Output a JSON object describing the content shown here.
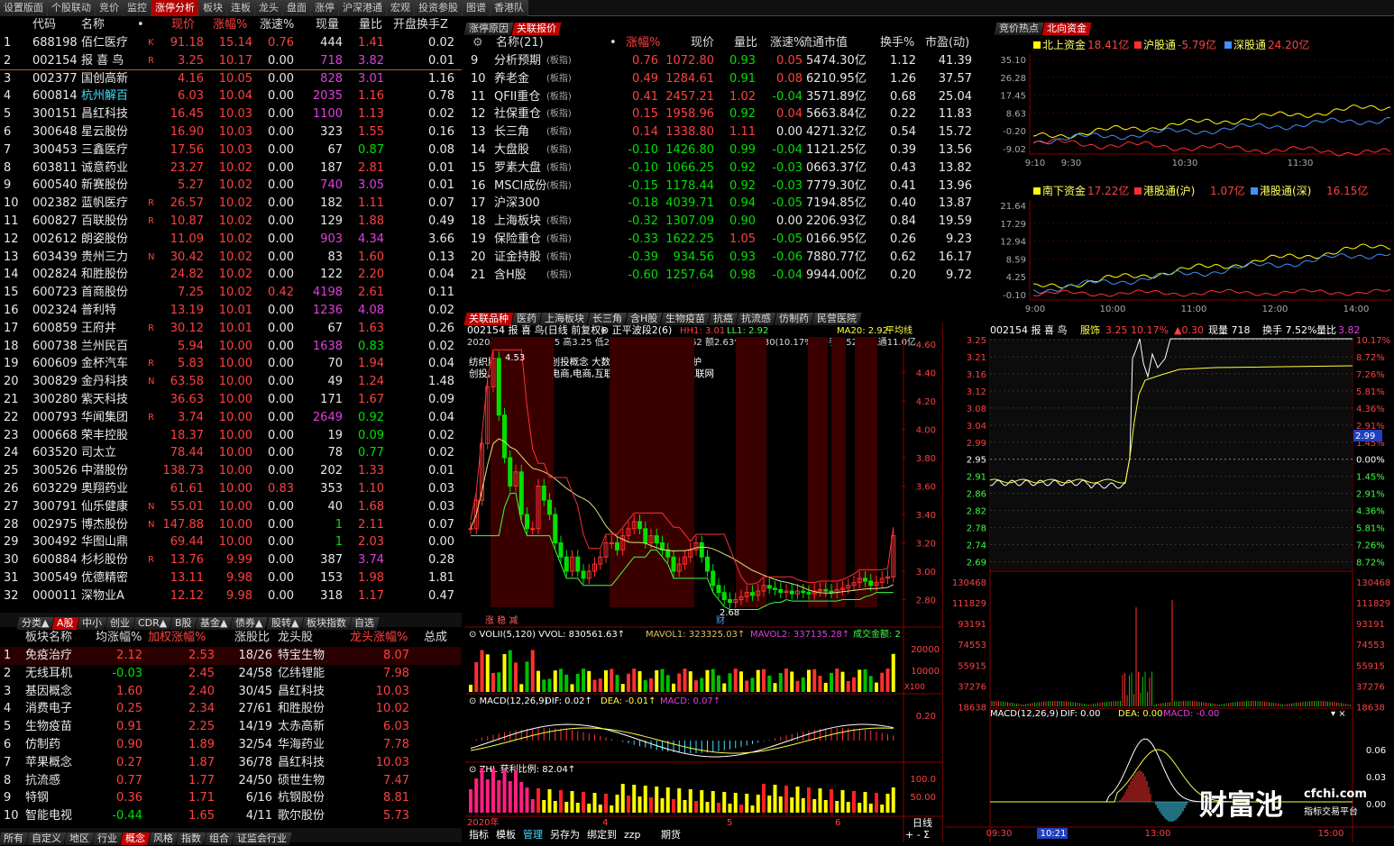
{
  "top_tabs": [
    {
      "label": "设置版面",
      "active": false
    },
    {
      "label": "个股联动",
      "active": false
    },
    {
      "label": "竞价",
      "active": false
    },
    {
      "label": "监控",
      "active": false
    },
    {
      "label": "涨停分析",
      "active": true
    },
    {
      "label": "板块",
      "active": false
    },
    {
      "label": "连板",
      "active": false
    },
    {
      "label": "龙头",
      "active": false
    },
    {
      "label": "盘面",
      "active": false
    },
    {
      "label": "涨停",
      "active": false
    },
    {
      "label": "沪深港通",
      "active": false
    },
    {
      "label": "宏观",
      "active": false
    },
    {
      "label": "投资参股",
      "active": false
    },
    {
      "label": "图谱",
      "active": false
    },
    {
      "label": "香港队",
      "active": false
    }
  ],
  "stock_list": {
    "headers": [
      "代码",
      "名称",
      "•",
      "现价",
      "涨幅%",
      "涨速%",
      "现量",
      "量比",
      "开盘换手Z"
    ],
    "rows": [
      [
        "1",
        "688198",
        "佰仁医疗",
        "K",
        "91.18",
        "15.14",
        "0.76",
        "444",
        "1.41",
        "0.02"
      ],
      [
        "2",
        "002154",
        "报 喜 鸟",
        "R",
        "3.25",
        "10.17",
        "0.00",
        "718",
        "3.82",
        "0.01"
      ],
      [
        "3",
        "002377",
        "国创高新",
        "",
        "4.16",
        "10.05",
        "0.00",
        "828",
        "3.01",
        "1.16"
      ],
      [
        "4",
        "600814",
        "杭州解百",
        "",
        "6.03",
        "10.04",
        "0.00",
        "2035",
        "1.16",
        "0.78"
      ],
      [
        "5",
        "300151",
        "昌红科技",
        "",
        "16.45",
        "10.03",
        "0.00",
        "1100",
        "1.13",
        "0.02"
      ],
      [
        "6",
        "300648",
        "星云股份",
        "",
        "16.90",
        "10.03",
        "0.00",
        "323",
        "1.55",
        "0.16"
      ],
      [
        "7",
        "300453",
        "三鑫医疗",
        "",
        "17.56",
        "10.03",
        "0.00",
        "67",
        "0.87",
        "0.08"
      ],
      [
        "8",
        "603811",
        "诚意药业",
        "",
        "23.27",
        "10.02",
        "0.00",
        "187",
        "2.81",
        "0.01"
      ],
      [
        "9",
        "600540",
        "新赛股份",
        "",
        "5.27",
        "10.02",
        "0.00",
        "740",
        "3.05",
        "0.01"
      ],
      [
        "10",
        "002382",
        "蓝帆医疗",
        "R",
        "26.57",
        "10.02",
        "0.00",
        "182",
        "1.11",
        "0.07"
      ],
      [
        "11",
        "600827",
        "百联股份",
        "R",
        "10.87",
        "10.02",
        "0.00",
        "129",
        "1.88",
        "0.49"
      ],
      [
        "12",
        "002612",
        "朗姿股份",
        "",
        "11.09",
        "10.02",
        "0.00",
        "903",
        "4.34",
        "3.66"
      ],
      [
        "13",
        "603439",
        "贵州三力",
        "N",
        "30.42",
        "10.02",
        "0.00",
        "83",
        "1.60",
        "0.13"
      ],
      [
        "14",
        "002824",
        "和胜股份",
        "",
        "24.82",
        "10.02",
        "0.00",
        "122",
        "2.20",
        "0.04"
      ],
      [
        "15",
        "600723",
        "首商股份",
        "",
        "7.25",
        "10.02",
        "0.42",
        "4198",
        "2.61",
        "0.11"
      ],
      [
        "16",
        "002324",
        "普利特",
        "",
        "13.19",
        "10.01",
        "0.00",
        "1236",
        "4.08",
        "0.02"
      ],
      [
        "17",
        "600859",
        "王府井",
        "R",
        "30.12",
        "10.01",
        "0.00",
        "67",
        "1.63",
        "0.26"
      ],
      [
        "18",
        "600738",
        "兰州民百",
        "",
        "5.94",
        "10.00",
        "0.00",
        "1638",
        "0.83",
        "0.02"
      ],
      [
        "19",
        "600609",
        "金杯汽车",
        "R",
        "5.83",
        "10.00",
        "0.00",
        "70",
        "1.94",
        "0.04"
      ],
      [
        "20",
        "300829",
        "金丹科技",
        "N",
        "63.58",
        "10.00",
        "0.00",
        "49",
        "1.24",
        "1.48"
      ],
      [
        "21",
        "300280",
        "紫天科技",
        "",
        "36.63",
        "10.00",
        "0.00",
        "171",
        "1.67",
        "0.09"
      ],
      [
        "22",
        "000793",
        "华闻集团",
        "R",
        "3.74",
        "10.00",
        "0.00",
        "2649",
        "0.92",
        "0.04"
      ],
      [
        "23",
        "000668",
        "荣丰控股",
        "",
        "18.37",
        "10.00",
        "0.00",
        "19",
        "0.09",
        "0.02"
      ],
      [
        "24",
        "603520",
        "司太立",
        "",
        "78.44",
        "10.00",
        "0.00",
        "78",
        "0.77",
        "0.02"
      ],
      [
        "25",
        "300526",
        "中潜股份",
        "",
        "138.73",
        "10.00",
        "0.00",
        "202",
        "1.33",
        "0.01"
      ],
      [
        "26",
        "603229",
        "奥翔药业",
        "",
        "61.61",
        "10.00",
        "0.83",
        "353",
        "1.10",
        "0.03"
      ],
      [
        "27",
        "300791",
        "仙乐健康",
        "N",
        "55.01",
        "10.00",
        "0.00",
        "40",
        "1.68",
        "0.03"
      ],
      [
        "28",
        "002975",
        "博杰股份",
        "N",
        "147.88",
        "10.00",
        "0.00",
        "1",
        "2.11",
        "0.07"
      ],
      [
        "29",
        "300492",
        "华图山鼎",
        "",
        "69.44",
        "10.00",
        "0.00",
        "1",
        "2.03",
        "0.00"
      ],
      [
        "30",
        "600884",
        "杉杉股份",
        "R",
        "13.76",
        "9.99",
        "0.00",
        "387",
        "3.74",
        "0.28"
      ],
      [
        "31",
        "300549",
        "优德精密",
        "",
        "13.11",
        "9.98",
        "0.00",
        "153",
        "1.98",
        "1.81"
      ],
      [
        "32",
        "000011",
        "深物业A",
        "",
        "12.12",
        "9.98",
        "0.00",
        "318",
        "1.17",
        "0.47"
      ]
    ]
  },
  "left_mid_tabs": [
    "分类▲",
    "A股",
    "中小",
    "创业",
    "CDR▲",
    "B股",
    "基金▲",
    "债券▲",
    "股转▲",
    "板块指数",
    "自选"
  ],
  "sector_list": {
    "headers": [
      "板块名称",
      "均涨幅%",
      "加权涨幅%",
      "涨股比",
      "龙头股",
      "龙头涨幅%",
      "总成"
    ],
    "rows": [
      [
        "1",
        "免疫治疗",
        "2.12",
        "2.53",
        "18/26",
        "特宝生物",
        "8.07"
      ],
      [
        "2",
        "无线耳机",
        "-0.03",
        "2.45",
        "24/58",
        "亿纬锂能",
        "7.98"
      ],
      [
        "3",
        "基因概念",
        "1.60",
        "2.40",
        "30/45",
        "昌红科技",
        "10.03"
      ],
      [
        "4",
        "消费电子",
        "0.25",
        "2.34",
        "27/61",
        "和胜股份",
        "10.02"
      ],
      [
        "5",
        "生物疫苗",
        "0.91",
        "2.25",
        "14/19",
        "太赤高新",
        "6.03"
      ],
      [
        "6",
        "仿制药",
        "0.90",
        "1.89",
        "32/54",
        "华海药业",
        "7.78"
      ],
      [
        "7",
        "苹果概念",
        "0.27",
        "1.87",
        "36/78",
        "昌红科技",
        "10.03"
      ],
      [
        "8",
        "抗流感",
        "0.77",
        "1.77",
        "24/50",
        "硕世生物",
        "7.47"
      ],
      [
        "9",
        "特钢",
        "0.36",
        "1.71",
        "6/16",
        "杭钢股份",
        "8.81"
      ],
      [
        "10",
        "智能电视",
        "-0.44",
        "1.65",
        "4/11",
        "歌尔股份",
        "5.73"
      ]
    ]
  },
  "bottom_tabs": [
    "所有",
    "自定义",
    "地区",
    "行业",
    "概念",
    "风格",
    "指数",
    "组合",
    "证监会行业"
  ],
  "mid_top_tabs": [
    "涨停原因",
    "关联报价"
  ],
  "index_list": {
    "headers": [
      "名称(21)",
      "•",
      "涨幅%",
      "现价",
      "量比",
      "涨速%",
      "流通市值",
      "换手%",
      "市盈(动)"
    ],
    "rows": [
      [
        "9",
        "分析预期",
        "(板指)",
        "0.76",
        "1072.80",
        "0.93",
        "0.05",
        "5474.30亿",
        "1.12",
        "41.39"
      ],
      [
        "10",
        "养老金",
        "(板指)",
        "0.49",
        "1284.61",
        "0.91",
        "0.08",
        "6210.95亿",
        "1.26",
        "37.57"
      ],
      [
        "11",
        "QFII重仓",
        "(板指)",
        "0.41",
        "2457.21",
        "1.02",
        "-0.04",
        "3571.89亿",
        "0.68",
        "25.04"
      ],
      [
        "12",
        "社保重仓",
        "(板指)",
        "0.15",
        "1958.96",
        "0.92",
        "0.04",
        "5663.84亿",
        "0.22",
        "11.83"
      ],
      [
        "13",
        "长三角",
        "(板指)",
        "0.14",
        "1338.80",
        "1.11",
        "0.00",
        "4271.32亿",
        "0.54",
        "15.72"
      ],
      [
        "14",
        "大盘股",
        "(板指)",
        "-0.10",
        "1426.80",
        "0.99",
        "-0.04",
        "1121.25亿",
        "0.39",
        "13.56"
      ],
      [
        "15",
        "罗素大盘",
        "(板指)",
        "-0.10",
        "1066.25",
        "0.92",
        "-0.03",
        "0663.37亿",
        "0.43",
        "13.82"
      ],
      [
        "16",
        "MSCI成份",
        "(板指)",
        "-0.15",
        "1178.44",
        "0.92",
        "-0.03",
        "7779.30亿",
        "0.41",
        "13.96"
      ],
      [
        "17",
        "沪深300",
        "",
        "-0.18",
        "4039.71",
        "0.94",
        "-0.05",
        "7194.85亿",
        "0.40",
        "13.87"
      ],
      [
        "18",
        "上海板块",
        "(板指)",
        "-0.32",
        "1307.09",
        "0.90",
        "0.00",
        "2206.93亿",
        "0.84",
        "19.59"
      ],
      [
        "19",
        "保险重仓",
        "(板指)",
        "-0.33",
        "1622.25",
        "1.05",
        "-0.05",
        "0166.95亿",
        "0.26",
        "9.23"
      ],
      [
        "20",
        "证金持股",
        "(板指)",
        "-0.39",
        "934.56",
        "0.93",
        "-0.06",
        "7880.77亿",
        "0.62",
        "16.17"
      ],
      [
        "21",
        "含H股",
        "(板指)",
        "-0.60",
        "1257.64",
        "0.98",
        "-0.04",
        "9944.00亿",
        "0.20",
        "9.72"
      ]
    ]
  },
  "mid_bottom_tabs": [
    "关联品种",
    "医药",
    "上海板块",
    "长三角",
    "含H股",
    "生物疫苗",
    "抗癌",
    "抗流感",
    "仿制药",
    "民营医院"
  ],
  "kline": {
    "title": "002154 报 喜 鸟(日线 前复权)",
    "indicator": "正平波段2(6)",
    "hh": "HH1: 3.01",
    "ll": "LL1: 2.92",
    "ma20": "MA20: 2.92",
    "avg": "平均线",
    "date_line": "2020/06/10三 开2.95 高3.25 低2.90 收3.25 量830562 额2.63亿 幅0.30(10.17%) 换手7.52% 流通11.0亿",
    "concepts1": "纺织服饰 浙江板块 创投概念 大数据 网贷概念 口罩防护",
    "concepts2": "创投,电子商务,跨境电商,电商,互联金融,大数据,移动互联网",
    "y_labels": [
      "4.60",
      "4.40",
      "4.20",
      "4.00",
      "3.80",
      "3.60",
      "3.40",
      "3.20",
      "3.00",
      "2.80"
    ],
    "high_label": "4.53",
    "low_label": "2.68",
    "tag": "涨 稳 减",
    "cai": "财",
    "vol_title": "VOLII(5,120) VVOL: 830561.63↑",
    "mavol1": "MAVOL1: 323325.03↑",
    "mavol2": "MAVOL2: 337135.28↑",
    "amount": "成交金额: 2",
    "vol_labels": [
      "20000",
      "10000",
      "X100"
    ],
    "macd_title": "MACD(12,26,9)",
    "macd_dif": "DIF: 0.02↑",
    "macd_dea": "DEA: -0.01↑",
    "macd_macd": "MACD: 0.07↑",
    "macd_label": "0.20",
    "zhl_title": "ZHL 获利比例: 82.04↑",
    "zhl_labels": [
      "100.0",
      "50.00"
    ],
    "x_labels": [
      "2020年",
      "4",
      "5",
      "6"
    ],
    "period": "日线",
    "toolbar": [
      "指标",
      "模板",
      "管理",
      "另存为",
      "绑定到",
      "zzp",
      "期货"
    ]
  },
  "right_tabs": [
    "竞价热点",
    "北向资金"
  ],
  "north": {
    "legend": [
      {
        "label": "北上资金",
        "value": "18.41亿",
        "color": "#ffff00"
      },
      {
        "label": "沪股通",
        "value": "-5.79亿",
        "color": "#ff3030"
      },
      {
        "label": "深股通",
        "value": "24.20亿",
        "color": "#4090ff"
      }
    ],
    "y_labels": [
      "35.10",
      "26.28",
      "17.45",
      "8.63",
      "-0.20",
      "-9.02"
    ],
    "x_labels": [
      "9:10",
      "9:30",
      "10:30",
      "11:30"
    ]
  },
  "south": {
    "legend": [
      {
        "label": "南下资金",
        "value": "17.22亿",
        "color": "#ffff00"
      },
      {
        "label": "港股通(沪)",
        "value": "1.07亿",
        "color": "#ff3030"
      },
      {
        "label": "港股通(深)",
        "value": "16.15亿",
        "color": "#4090ff"
      }
    ],
    "y_labels": [
      "21.64",
      "17.29",
      "12.94",
      "8.59",
      "4.25",
      "-0.10"
    ],
    "x_labels": [
      "9:00",
      "10:00",
      "11:00",
      "12:00",
      "14:00"
    ]
  },
  "intraday": {
    "title": "002154 报 喜 鸟",
    "sector": "服饰",
    "price": "3.25",
    "pct": "10.17%",
    "chg": "▲0.30",
    "vol": "现量 718",
    "turnover": "换手 7.52%",
    "ratio_label": "量比",
    "ratio": "3.82",
    "y_left": [
      "3.25",
      "3.21",
      "3.16",
      "3.12",
      "3.08",
      "3.04",
      "2.99",
      "2.95",
      "2.91",
      "2.86",
      "2.82",
      "2.78",
      "2.74",
      "2.69"
    ],
    "y_right": [
      "10.17%",
      "8.72%",
      "7.26%",
      "5.81%",
      "4.36%",
      "2.91%",
      "1.45%",
      "0.00%",
      "1.45%",
      "2.91%",
      "4.36%",
      "5.81%",
      "7.26%",
      "8.72%"
    ],
    "cur_price": "2.99",
    "vol_labels": [
      "130468",
      "111829",
      "93191",
      "74553",
      "55915",
      "37276",
      "18638"
    ],
    "macd_title": "MACD(12,26,9)",
    "dif": "DIF: 0.00",
    "dea": "DEA: 0.00",
    "macd": "MACD: -0.00",
    "macd_y": [
      "0.06",
      "0.03",
      "0.00"
    ],
    "x_labels": [
      "09:30",
      "10:21",
      "13:00",
      "15:00"
    ]
  },
  "logo": {
    "text": "财富池",
    "site": "cfchi.com",
    "slogan": "指标交易平台"
  }
}
